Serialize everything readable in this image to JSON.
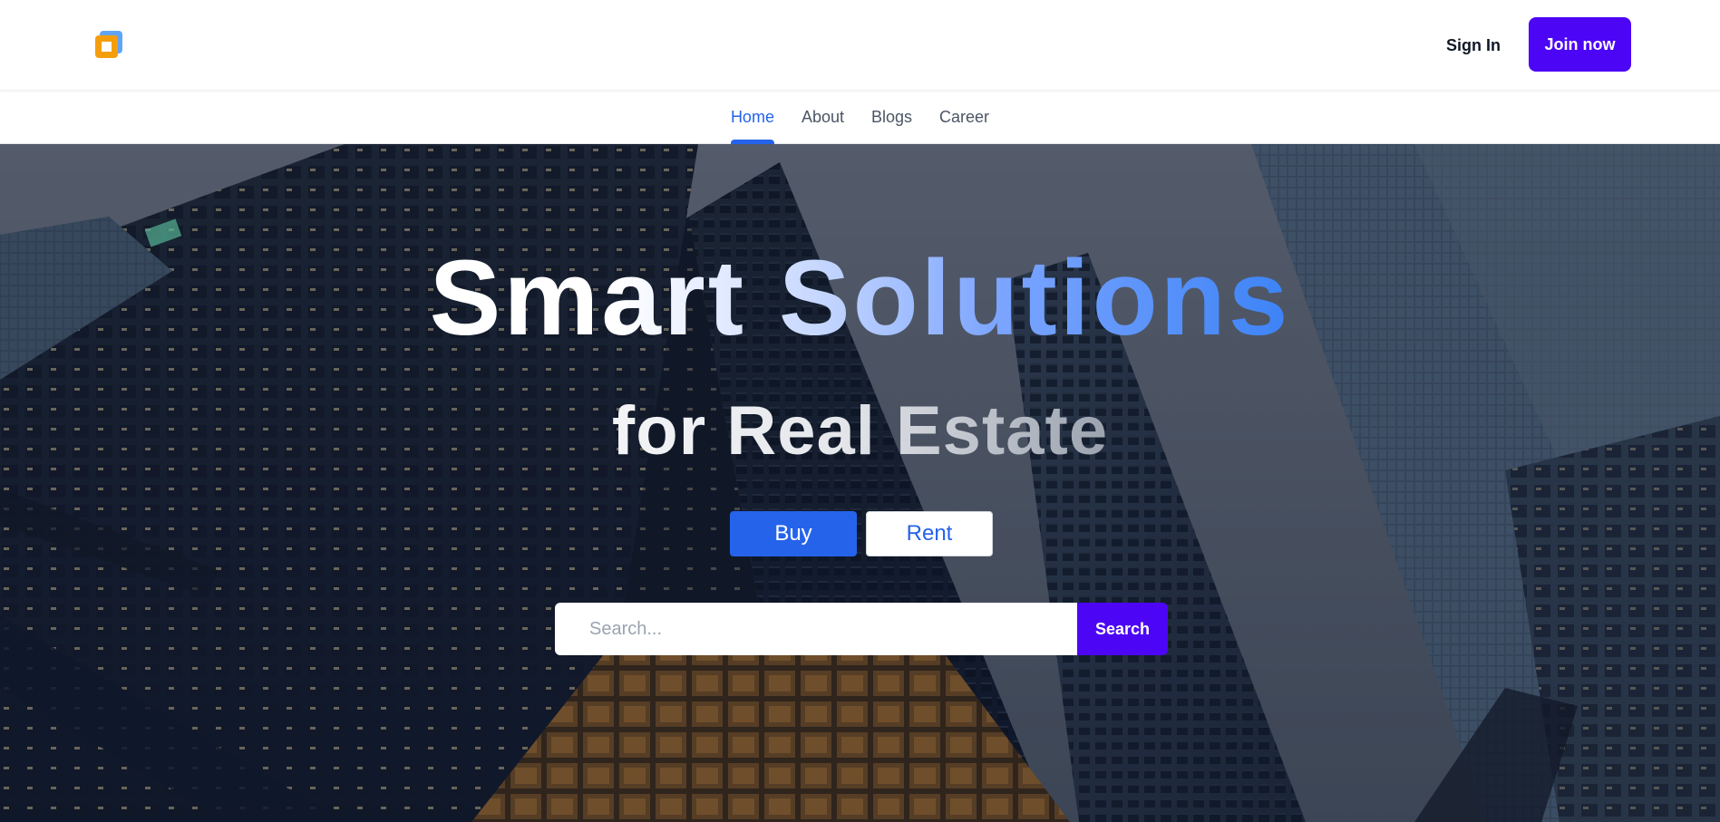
{
  "header": {
    "logo_icon": "stacked-squares-logo-icon",
    "sign_in_label": "Sign In",
    "join_label": "Join now"
  },
  "nav": {
    "items": [
      {
        "label": "Home",
        "active": true
      },
      {
        "label": "About",
        "active": false
      },
      {
        "label": "Blogs",
        "active": false
      },
      {
        "label": "Career",
        "active": false
      }
    ]
  },
  "hero": {
    "headline": "Smart Solutions",
    "subheadline": "for Real Estate",
    "buy_label": "Buy",
    "rent_label": "Rent",
    "search_placeholder": "Search...",
    "search_button_label": "Search"
  },
  "colors": {
    "accent_purple": "#4c06f5",
    "accent_blue": "#2563eb",
    "text_dark": "#111827",
    "nav_text": "#4b5563"
  }
}
